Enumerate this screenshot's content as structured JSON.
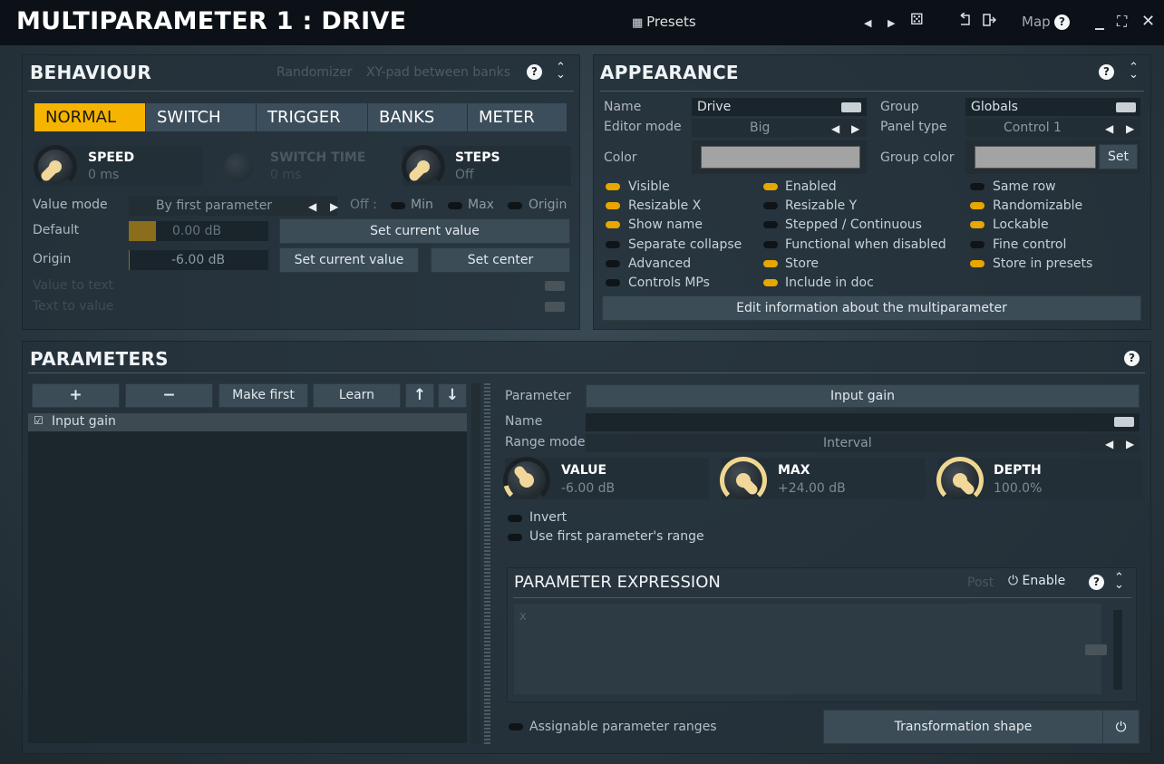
{
  "title": "MULTIPARAMETER 1 : DRIVE",
  "toolbar": {
    "presets": "Presets",
    "map": "Map",
    "prev": "◀",
    "next": "▶",
    "dice": "⚄",
    "help": "?",
    "minimize": "_",
    "fullscreen": "⛶",
    "close": "✕"
  },
  "behaviour": {
    "title": "BEHAVIOUR",
    "randomizer": "Randomizer",
    "xy_pad": "XY-pad between banks",
    "modes": [
      "NORMAL",
      "SWITCH",
      "TRIGGER",
      "BANKS",
      "METER"
    ],
    "active_mode": "NORMAL",
    "speed": {
      "label": "SPEED",
      "value": "0 ms"
    },
    "switch_time": {
      "label": "SWITCH TIME",
      "value": "0 ms"
    },
    "steps": {
      "label": "STEPS",
      "value": "Off"
    },
    "value_mode": {
      "label": "Value mode",
      "value": "By first parameter",
      "off": "Off :",
      "min": "Min",
      "max": "Max",
      "origin": "Origin"
    },
    "default": {
      "label": "Default",
      "value": "0.00 dB",
      "button": "Set current value"
    },
    "origin": {
      "label": "Origin",
      "value": "-6.00 dB",
      "button1": "Set current value",
      "button2": "Set center"
    },
    "value_to_text": "Value to text",
    "text_to_value": "Text to value"
  },
  "appearance": {
    "title": "APPEARANCE",
    "name_label": "Name",
    "name_value": "Drive",
    "group_label": "Group",
    "group_value": "Globals",
    "editor_mode_label": "Editor mode",
    "editor_mode_value": "Big",
    "panel_type_label": "Panel type",
    "panel_type_value": "Control 1",
    "color_label": "Color",
    "group_color_label": "Group color",
    "set": "Set",
    "flags": [
      {
        "label": "Visible",
        "on": true
      },
      {
        "label": "Enabled",
        "on": true
      },
      {
        "label": "Same row",
        "on": false
      },
      {
        "label": "Resizable X",
        "on": true
      },
      {
        "label": "Resizable Y",
        "on": false
      },
      {
        "label": "Randomizable",
        "on": true
      },
      {
        "label": "Show name",
        "on": true
      },
      {
        "label": "Stepped / Continuous",
        "on": false
      },
      {
        "label": "Lockable",
        "on": true
      },
      {
        "label": "Separate collapse",
        "on": false
      },
      {
        "label": "Functional when disabled",
        "on": false
      },
      {
        "label": "Fine control",
        "on": false
      },
      {
        "label": "Advanced",
        "on": false
      },
      {
        "label": "Store",
        "on": true
      },
      {
        "label": "Store in presets",
        "on": true
      },
      {
        "label": "Controls MPs",
        "on": false
      },
      {
        "label": "Include in doc",
        "on": true
      }
    ],
    "edit_info": "Edit information about the multiparameter"
  },
  "parameters": {
    "title": "PARAMETERS",
    "add": "+",
    "remove": "−",
    "make_first": "Make first",
    "learn": "Learn",
    "up": "↑",
    "down": "↓",
    "list": [
      "Input gain"
    ],
    "parameter_label": "Parameter",
    "parameter_value": "Input gain",
    "name_label": "Name",
    "range_mode_label": "Range mode",
    "range_mode_value": "Interval",
    "value": {
      "label": "VALUE",
      "value": "-6.00 dB"
    },
    "max": {
      "label": "MAX",
      "value": "+24.00 dB"
    },
    "depth": {
      "label": "DEPTH",
      "value": "100.0%"
    },
    "invert": "Invert",
    "use_first": "Use first parameter's range",
    "expression": {
      "title": "PARAMETER EXPRESSION",
      "post": "Post",
      "enable": "Enable",
      "var": "x"
    },
    "assignable": "Assignable parameter ranges",
    "transformation": "Transformation shape"
  }
}
